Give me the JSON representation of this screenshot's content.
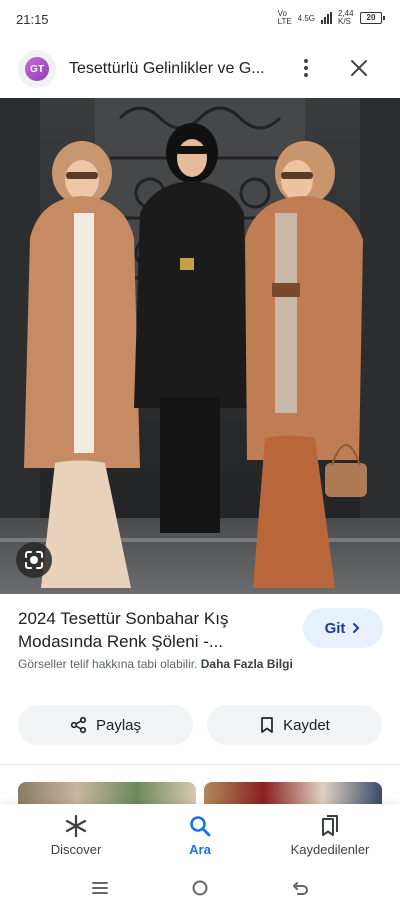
{
  "status_bar": {
    "time": "21:15",
    "network_label": "Vo LTE",
    "network_type": "4.5G",
    "data_speed": "2,44 K/S",
    "battery": "20"
  },
  "header": {
    "site_logo_text": "GT",
    "title": "Tesettürlü Gelinlikler ve G..."
  },
  "result": {
    "title": "2024 Tesettür Sonbahar Kış Modasında Renk Şöleni -...",
    "visit_label": "Git",
    "copyright_text": "Görseller telif hakkına tabi olabilir.",
    "more_info_link": "Daha Fazla Bilgi"
  },
  "actions": {
    "share_label": "Paylaş",
    "save_label": "Kaydet"
  },
  "bottom_nav": {
    "items": [
      {
        "label": "Discover",
        "icon": "asterisk-icon"
      },
      {
        "label": "Ara",
        "icon": "search-icon",
        "active": true
      },
      {
        "label": "Kaydedilenler",
        "icon": "bookmarks-icon"
      }
    ]
  },
  "colors": {
    "accent": "#1a73e8",
    "visit_button_bg": "#e8f0fe",
    "pill_bg": "#f1f3f4"
  }
}
